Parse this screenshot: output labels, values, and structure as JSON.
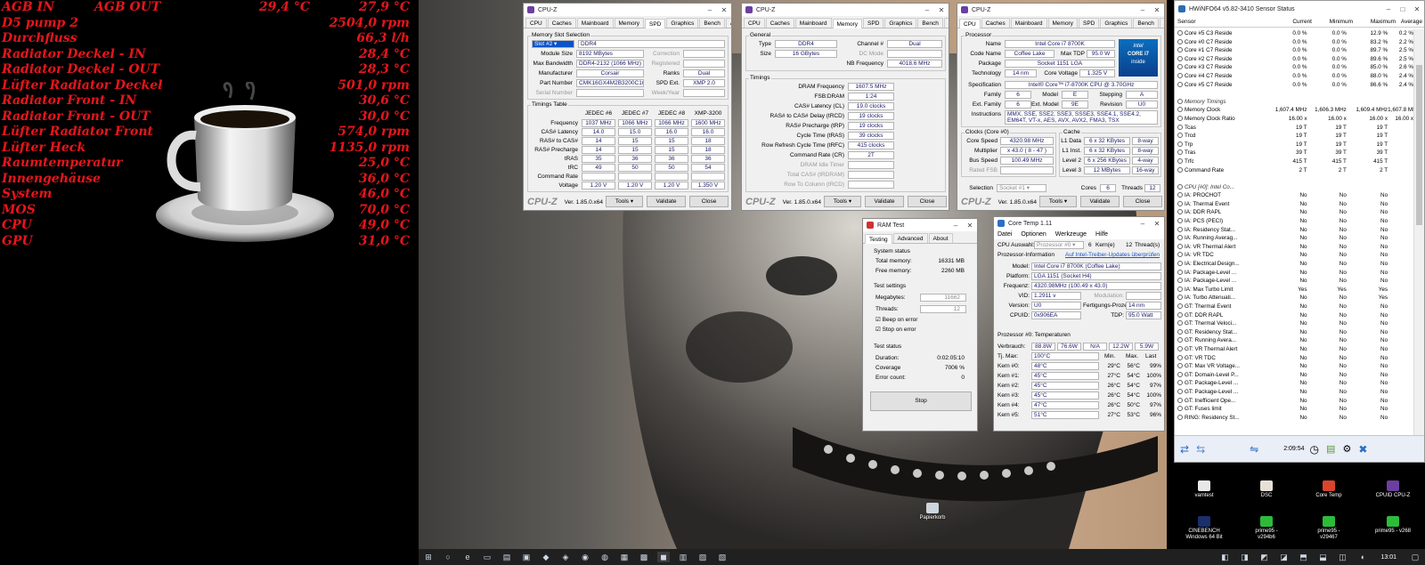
{
  "sensors": [
    {
      "label": "AGB IN",
      "mid": "AGB OUT",
      "mid_val": "29,4 °C",
      "value": "27,9 °C"
    },
    {
      "label": "D5 pump 2",
      "value": "2504,0 rpm"
    },
    {
      "label": "Durchfluss",
      "value": "66,3 l/h"
    },
    {
      "label": "Radiator Deckel - IN",
      "value": "28,4 °C"
    },
    {
      "label": "Radiator Deckel - OUT",
      "value": "28,3 °C"
    },
    {
      "label": "Lüfter Radiator Deckel",
      "value": "501,0 rpm"
    },
    {
      "label": "Radiator Front - IN",
      "value": "30,6 °C"
    },
    {
      "label": "Radiator Front - OUT",
      "value": "30,0 °C"
    },
    {
      "label": "Lüfter Radiator Front",
      "value": "574,0 rpm"
    },
    {
      "label": "Lüfter Heck",
      "value": "1135,0 rpm"
    },
    {
      "label": "Raumtemperatur",
      "value": "25,0 °C"
    },
    {
      "label": "Innengehäuse",
      "value": "36,0 °C"
    },
    {
      "label": "System",
      "value": "46,0 °C"
    },
    {
      "label": "MOS",
      "value": "70,0 °C"
    },
    {
      "label": "CPU",
      "value": "49,0 °C"
    },
    {
      "label": "GPU",
      "value": "31,0 °C"
    }
  ],
  "cpuz_spd": {
    "title": "CPU-Z",
    "tabs": [
      "CPU",
      "Caches",
      "Mainboard",
      "Memory",
      "SPD",
      "Graphics",
      "Bench",
      "About"
    ],
    "slot_group": "Memory Slot Selection",
    "slot": "Slot #2",
    "type": "DDR4",
    "module_size_l": "Module Size",
    "module_size": "8192 MBytes",
    "correction_l": "Correction",
    "max_bw_l": "Max Bandwidth",
    "max_bw": "DDR4-2132 (1066 MHz)",
    "registered_l": "Registered",
    "manufacturer_l": "Manufacturer",
    "manufacturer": "Corsair",
    "ranks_l": "Ranks",
    "ranks": "Dual",
    "part_l": "Part Number",
    "part": "CMK16GX4M2B3200C16",
    "spdext_l": "SPD Ext.",
    "spdext": "XMP 2.0",
    "serial_l": "Serial Number",
    "week_l": "Week/Year",
    "timings_group": "Timings Table",
    "cols": [
      "JEDEC #6",
      "JEDEC #7",
      "JEDEC #8",
      "XMP-3200"
    ],
    "rows": [
      {
        "l": "Frequency",
        "v": [
          "1037 MHz",
          "1066 MHz",
          "1066 MHz",
          "1600 MHz"
        ]
      },
      {
        "l": "CAS# Latency",
        "v": [
          "14.0",
          "15.0",
          "16.0",
          "16.0"
        ]
      },
      {
        "l": "RAS# to CAS#",
        "v": [
          "14",
          "15",
          "15",
          "18"
        ]
      },
      {
        "l": "RAS# Precharge",
        "v": [
          "14",
          "15",
          "15",
          "18"
        ]
      },
      {
        "l": "tRAS",
        "v": [
          "35",
          "36",
          "36",
          "36"
        ]
      },
      {
        "l": "tRC",
        "v": [
          "49",
          "50",
          "50",
          "54"
        ]
      },
      {
        "l": "Command Rate",
        "v": [
          "",
          "",
          "",
          ""
        ]
      },
      {
        "l": "Voltage",
        "v": [
          "1.20 V",
          "1.20 V",
          "1.20 V",
          "1.350 V"
        ]
      }
    ],
    "logo": "CPU-Z",
    "ver": "Ver. 1.85.0.x64",
    "tools": "Tools",
    "validate": "Validate",
    "close": "Close"
  },
  "cpuz_mem": {
    "title": "CPU-Z",
    "tabs": [
      "CPU",
      "Caches",
      "Mainboard",
      "Memory",
      "SPD",
      "Graphics",
      "Bench",
      "About"
    ],
    "general": "General",
    "type_l": "Type",
    "type": "DDR4",
    "channel_l": "Channel #",
    "channel": "Dual",
    "size_l": "Size",
    "size": "16 GBytes",
    "dcmode_l": "DC Mode",
    "nbfreq_l": "NB Frequency",
    "nbfreq": "4018.6 MHz",
    "timings": "Timings",
    "trows": [
      {
        "l": "DRAM Frequency",
        "v": "1607.5 MHz"
      },
      {
        "l": "FSB:DRAM",
        "v": "1:24"
      },
      {
        "l": "CAS# Latency (CL)",
        "v": "19.0 clocks"
      },
      {
        "l": "RAS# to CAS# Delay (tRCD)",
        "v": "19 clocks"
      },
      {
        "l": "RAS# Precharge (tRP)",
        "v": "19 clocks"
      },
      {
        "l": "Cycle Time (tRAS)",
        "v": "39 clocks"
      },
      {
        "l": "Row Refresh Cycle Time (tRFC)",
        "v": "415 clocks"
      },
      {
        "l": "Command Rate (CR)",
        "v": "2T"
      },
      {
        "l": "DRAM Idle Timer",
        "v": ""
      },
      {
        "l": "Total CAS# (tRDRAM)",
        "v": ""
      },
      {
        "l": "Row To Column (tRCD)",
        "v": ""
      }
    ],
    "logo": "CPU-Z",
    "ver": "Ver. 1.85.0.x64",
    "tools": "Tools",
    "validate": "Validate",
    "close": "Close"
  },
  "cpuz_cpu": {
    "title": "CPU-Z",
    "tabs": [
      "CPU",
      "Caches",
      "Mainboard",
      "Memory",
      "SPD",
      "Graphics",
      "Bench",
      "About"
    ],
    "processor": "Processor",
    "name_l": "Name",
    "name": "Intel Core i7 8700K",
    "code_l": "Code Name",
    "code": "Coffee Lake",
    "tdp_l": "Max TDP",
    "tdp": "95.0 W",
    "pkg_l": "Package",
    "pkg": "Socket 1151 LGA",
    "tech_l": "Technology",
    "tech": "14 nm",
    "cv_l": "Core Voltage",
    "cv": "1.325 V",
    "spec_l": "Specification",
    "spec": "Intel® Core™ i7-8700K CPU @ 3.70GHz",
    "family_l": "Family",
    "family": "6",
    "model_l": "Model",
    "model": "E",
    "stepping_l": "Stepping",
    "stepping": "A",
    "extfam_l": "Ext. Family",
    "extfam": "6",
    "extmodel_l": "Ext. Model",
    "extmodel": "9E",
    "rev_l": "Revision",
    "rev": "U0",
    "instr_l": "Instructions",
    "instr": "MMX, SSE, SSE2, SSE3, SSSE3, SSE4.1, SSE4.2, EM64T, VT-x, AES, AVX, AVX2, FMA3, TSX",
    "clocks": "Clocks (Core #0)",
    "cs_l": "Core Speed",
    "cs": "4320.98 MHz",
    "mult_l": "Multiplier",
    "mult": "x 43.0 ( 8 - 47 )",
    "bus_l": "Bus Speed",
    "bus": "100.49 MHz",
    "fsb_l": "Rated FSB",
    "cache": "Cache",
    "l1d_l": "L1 Data",
    "l1d": "6 x 32 KBytes",
    "l1d_w": "8-way",
    "l1i_l": "L1 Inst.",
    "l1i": "6 x 32 KBytes",
    "l1i_w": "8-way",
    "l2_l": "Level 2",
    "l2": "6 x 256 KBytes",
    "l2_w": "4-way",
    "l3_l": "Level 3",
    "l3": "12 MBytes",
    "l3_w": "16-way",
    "sel_l": "Selection",
    "sel": "Socket #1",
    "cores_l": "Cores",
    "cores": "6",
    "threads_l": "Threads",
    "threads": "12",
    "badge_top": "intel",
    "badge_mid": "CORE i7",
    "badge_bot": "inside",
    "logo": "CPU-Z",
    "ver": "Ver. 1.85.0.x64",
    "tools": "Tools",
    "validate": "Validate",
    "close": "Close"
  },
  "ramtest": {
    "title": "RAM Test",
    "tabs": [
      "Testing",
      "Advanced",
      "About"
    ],
    "sys": "System status",
    "total_l": "Total memory:",
    "total": "16331 MB",
    "free_l": "Free memory:",
    "free": "2260 MB",
    "settings": "Test settings",
    "mb_l": "Megabytes:",
    "mb": "11662",
    "thr_l": "Threads:",
    "thr": "12",
    "beep": "Beep on error",
    "stop_err": "Stop on error",
    "status": "Test status",
    "dur_l": "Duration:",
    "dur": "0:02:05:10",
    "cov_l": "Coverage",
    "cov": "7006 %",
    "err_l": "Error count:",
    "err": "0",
    "stop": "Stop"
  },
  "coretemp": {
    "title": "Core Temp 1.11",
    "menu": [
      "Datei",
      "Optionen",
      "Werkzeuge",
      "Hilfe"
    ],
    "cpu_l": "CPU Auswahl:",
    "cpu": "Prozessor #0",
    "cores": "6",
    "cores_l": "Kern(e)",
    "thr": "12",
    "thr_l": "Thread(s)",
    "info_l": "Prozessor-Information",
    "link": "Auf Intel-Treiber-Updates überprüfen",
    "model_l": "Model:",
    "model": "Intel Core i7 8700K (Coffee Lake)",
    "plat_l": "Platform:",
    "plat": "LGA 1151 (Socket H4)",
    "freq_l": "Frequenz:",
    "freq": "4320.98MHz (100.49 x 43.0)",
    "vid_l": "VID:",
    "vid": "1.2911 v",
    "mod_l": "Modulation:",
    "ver_l": "Version:",
    "ver": "U0",
    "fp_l": "Fertigungs-Prozess:",
    "fp": "14 nm",
    "cpuid_l": "CPUID:",
    "cpuid": "0x906EA",
    "tdp_l": "TDP:",
    "tdp": "95.0 Watt",
    "temps": "Prozessor #0: Temperaturen",
    "power_l": "Verbrauch:",
    "power": [
      "88.8W",
      "76.6W",
      "N/A",
      "12.2W",
      "5.9W"
    ],
    "tj_l": "Tj. Max:",
    "tj": "100°C",
    "h_min": "Min.",
    "h_max": "Max.",
    "h_last": "Last",
    "kerns": [
      {
        "l": "Kern #0:",
        "t": "48°C",
        "mn": "29°C",
        "mx": "56°C",
        "ld": "99%"
      },
      {
        "l": "Kern #1:",
        "t": "45°C",
        "mn": "27°C",
        "mx": "54°C",
        "ld": "100%"
      },
      {
        "l": "Kern #2:",
        "t": "45°C",
        "mn": "26°C",
        "mx": "54°C",
        "ld": "97%"
      },
      {
        "l": "Kern #3:",
        "t": "45°C",
        "mn": "26°C",
        "mx": "54°C",
        "ld": "100%"
      },
      {
        "l": "Kern #4:",
        "t": "47°C",
        "mn": "26°C",
        "mx": "50°C",
        "ld": "97%"
      },
      {
        "l": "Kern #5:",
        "t": "51°C",
        "mn": "27°C",
        "mx": "53°C",
        "ld": "96%"
      }
    ]
  },
  "hwinfo": {
    "title": "HWiNFO64 v5.82-3410 Sensor Status",
    "cols": [
      "Sensor",
      "Current",
      "Minimum",
      "Maximum",
      "Average"
    ],
    "rows": [
      [
        "Core #5 C3 Reside",
        "0.0 %",
        "0.0 %",
        "12.9 %",
        "0.2 %"
      ],
      [
        "Core #0 C7 Reside",
        "0.0 %",
        "0.0 %",
        "83.2 %",
        "2.2 %"
      ],
      [
        "Core #1 C7 Reside",
        "0.0 %",
        "0.0 %",
        "89.7 %",
        "2.5 %"
      ],
      [
        "Core #2 C7 Reside",
        "0.0 %",
        "0.0 %",
        "89.6 %",
        "2.5 %"
      ],
      [
        "Core #3 C7 Reside",
        "0.0 %",
        "0.0 %",
        "85.0 %",
        "2.6 %"
      ],
      [
        "Core #4 C7 Reside",
        "0.0 %",
        "0.0 %",
        "88.0 %",
        "2.4 %"
      ],
      [
        "Core #5 C7 Reside",
        "0.0 %",
        "0.0 %",
        "86.6 %",
        "2.4 %"
      ],
      [
        "",
        "",
        "",
        "",
        ""
      ],
      [
        "Memory Timings",
        "",
        "",
        "",
        ""
      ],
      [
        "Memory Clock",
        "1,607.4 MHz",
        "1,606.3 MHz",
        "1,609.4 MHz",
        "1,607.8 MHz"
      ],
      [
        "Memory Clock Ratio",
        "16.00 x",
        "16.00 x",
        "16.00 x",
        "16.00 x"
      ],
      [
        "Tcas",
        "19 T",
        "19 T",
        "19 T",
        ""
      ],
      [
        "Trcd",
        "19 T",
        "19 T",
        "19 T",
        ""
      ],
      [
        "Trp",
        "19 T",
        "19 T",
        "19 T",
        ""
      ],
      [
        "Tras",
        "39 T",
        "39 T",
        "39 T",
        ""
      ],
      [
        "Trfc",
        "415 T",
        "415 T",
        "415 T",
        ""
      ],
      [
        "Command Rate",
        "2 T",
        "2 T",
        "2 T",
        ""
      ],
      [
        "",
        "",
        "",
        "",
        ""
      ],
      [
        "CPU [#0]: Intel Co...",
        "",
        "",
        "",
        ""
      ],
      [
        "IA: PROCHOT",
        "No",
        "No",
        "No",
        ""
      ],
      [
        "IA: Thermal Event",
        "No",
        "No",
        "No",
        ""
      ],
      [
        "IA: DDR RAPL",
        "No",
        "No",
        "No",
        ""
      ],
      [
        "IA: PCS (PECI)",
        "No",
        "No",
        "No",
        ""
      ],
      [
        "IA: Residency Stat...",
        "No",
        "No",
        "No",
        ""
      ],
      [
        "IA: Running Averag...",
        "No",
        "No",
        "No",
        ""
      ],
      [
        "IA: VR Thermal Alert",
        "No",
        "No",
        "No",
        ""
      ],
      [
        "IA: VR TDC",
        "No",
        "No",
        "No",
        ""
      ],
      [
        "IA: Electrical Design...",
        "No",
        "No",
        "No",
        ""
      ],
      [
        "IA: Package-Level ...",
        "No",
        "No",
        "No",
        ""
      ],
      [
        "IA: Package-Level ...",
        "No",
        "No",
        "No",
        ""
      ],
      [
        "IA: Max Turbo Limit",
        "Yes",
        "Yes",
        "Yes",
        ""
      ],
      [
        "IA: Turbo Attenuati...",
        "No",
        "No",
        "Yes",
        ""
      ],
      [
        "GT: Thermal Event",
        "No",
        "No",
        "No",
        ""
      ],
      [
        "GT: DDR RAPL",
        "No",
        "No",
        "No",
        ""
      ],
      [
        "GT: Thermal Veloci...",
        "No",
        "No",
        "No",
        ""
      ],
      [
        "GT: Residency Stat...",
        "No",
        "No",
        "No",
        ""
      ],
      [
        "GT: Running Avera...",
        "No",
        "No",
        "No",
        ""
      ],
      [
        "GT: VR Thermal Alert",
        "No",
        "No",
        "No",
        ""
      ],
      [
        "GT: VR TDC",
        "No",
        "No",
        "No",
        ""
      ],
      [
        "GT: Max VR Voltage...",
        "No",
        "No",
        "No",
        ""
      ],
      [
        "GT: Domain-Level P...",
        "No",
        "No",
        "No",
        ""
      ],
      [
        "GT: Package-Level ...",
        "No",
        "No",
        "No",
        ""
      ],
      [
        "GT: Package-Level ...",
        "No",
        "No",
        "No",
        ""
      ],
      [
        "GT: Inefficient Ope...",
        "No",
        "No",
        "No",
        ""
      ],
      [
        "GT: Fuses limit",
        "No",
        "No",
        "No",
        ""
      ],
      [
        "RING: Residency St...",
        "No",
        "No",
        "No",
        ""
      ]
    ],
    "time": "2:09:54"
  },
  "desktop": {
    "icons": [
      "Papierkorb",
      "vamtest",
      "DSC",
      "Core Temp",
      "CPUID CPU-Z",
      "CINEBENCH Windows 64 Bit",
      "prime95 - v294b6",
      "prime95 - v29467",
      "prime95 - v268"
    ]
  },
  "taskbar": {
    "time": "13:01"
  }
}
